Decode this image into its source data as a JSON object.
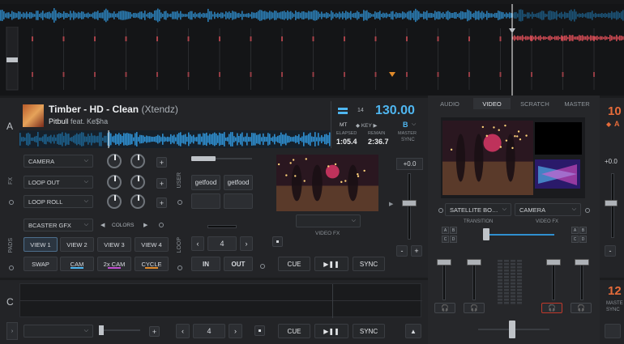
{
  "deckA": {
    "letter": "A",
    "title": "Timber  - HD - Clean",
    "remix": "(Xtendz)",
    "artist": "Pitbull",
    "feat": "feat. Ke$ha",
    "bpm": "130.00",
    "key_number": "14",
    "mt_label": "MT",
    "key_label": "KEY",
    "key_value": "B",
    "elapsed_label": "ELAPSED",
    "elapsed": "1:05.4",
    "remain_label": "REMAIN",
    "remain": "2:36.7",
    "master_label": "MASTER",
    "sync_label": "SYNC",
    "fx_label": "FX",
    "fx_slots": [
      "CAMERA",
      "LOOP OUT",
      "LOOP ROLL"
    ],
    "user_label": "USER",
    "user_buttons": [
      "getfood",
      "getfood"
    ],
    "pads_label": "PADS",
    "pads_mode": "BCASTER GFX",
    "colors_label": "COLORS",
    "pads": [
      "VIEW 1",
      "VIEW 2",
      "VIEW 3",
      "VIEW 4",
      "SWAP",
      "CAM",
      "2x CAM",
      "CYCLE"
    ],
    "loop_label": "LOOP",
    "loop_size": "4",
    "loop_in": "IN",
    "loop_out": "OUT",
    "video_fx_label": "VIDEO FX",
    "pitch_value": "+0.0",
    "cue": "CUE",
    "play_pause": "▶❚❚",
    "sync": "SYNC"
  },
  "mixer": {
    "tabs": [
      "AUDIO",
      "VIDEO",
      "SCRATCH",
      "MASTER"
    ],
    "active_tab": "VIDEO",
    "transition_source": "SATELLITE BO…",
    "transition_label": "TRANSITION",
    "video_fx_source": "CAMERA",
    "video_fx_label": "VIDEO FX",
    "abcd": [
      "A",
      "B",
      "C",
      "D"
    ],
    "headphone_icon": "headphones-icon"
  },
  "deckB": {
    "bpm_partial": "10",
    "key_partial": "A",
    "pitch_value": "+0.0"
  },
  "deckC": {
    "letter": "C",
    "loop_size": "4",
    "cue": "CUE",
    "play_pause": "▶❚❚",
    "sync": "SYNC"
  },
  "deckD": {
    "bpm_partial": "12",
    "master_label": "MASTE",
    "sync_label": "SYNC"
  },
  "colors": {
    "waveform_blue": "#2f8fd0",
    "waveform_red": "#e2505a",
    "bpm_blue": "#4fb6f0",
    "deckB_orange": "#e56b3a",
    "cam_line": "#4fb6f0",
    "2xcam_line": "#c04fd0",
    "cycle_line": "#e08a2a"
  }
}
